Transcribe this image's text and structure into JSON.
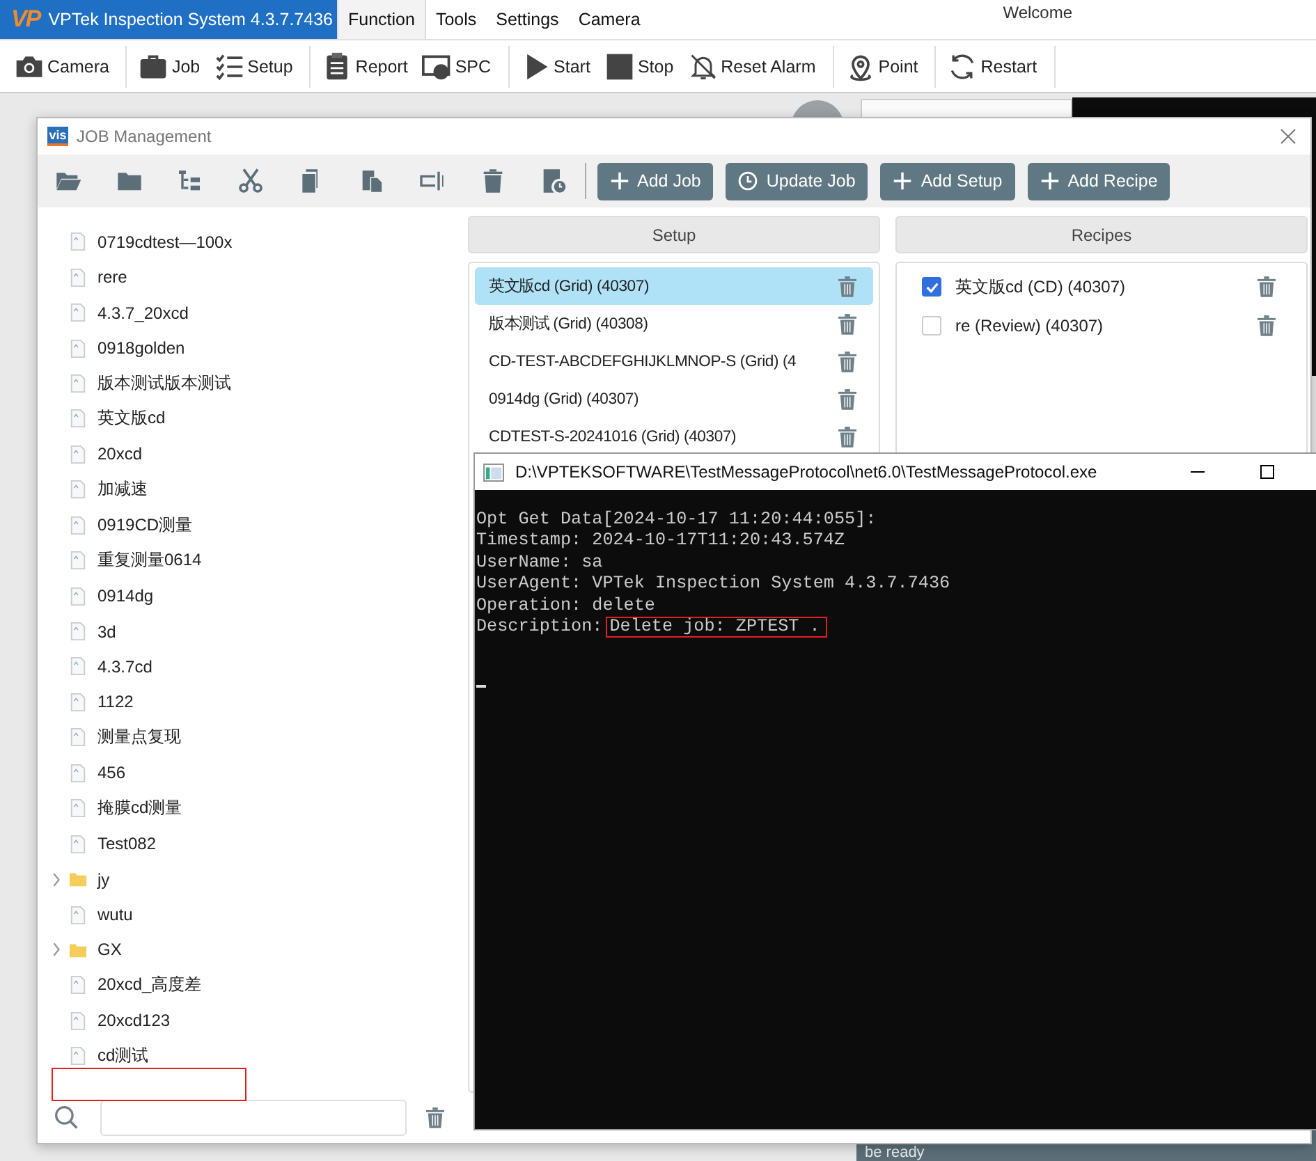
{
  "app": {
    "logo": "VP",
    "title": "VPTek Inspection System 4.3.7.7436",
    "greeting": "Welcome",
    "menu": [
      {
        "label": "Function",
        "selected": true
      },
      {
        "label": "Tools",
        "selected": false
      },
      {
        "label": "Settings",
        "selected": false
      },
      {
        "label": "Camera",
        "selected": false
      }
    ],
    "toolbar": [
      [
        {
          "label": "Camera",
          "kind": "camera"
        }
      ],
      [
        {
          "label": "Job",
          "kind": "job"
        },
        {
          "label": "Setup",
          "kind": "setup"
        }
      ],
      [
        {
          "label": "Report",
          "kind": "report"
        },
        {
          "label": "SPC",
          "kind": "spc"
        }
      ],
      [
        {
          "label": "Start",
          "kind": "start"
        },
        {
          "label": "Stop",
          "kind": "stop"
        },
        {
          "label": "Reset Alarm",
          "kind": "alarm"
        }
      ],
      [
        {
          "label": "Point",
          "kind": "point"
        }
      ],
      [
        {
          "label": "Restart",
          "kind": "restart"
        }
      ]
    ],
    "status": "be ready"
  },
  "job_window": {
    "logo": "vis",
    "title": "JOB Management",
    "tools": [
      {
        "kind": "open"
      },
      {
        "kind": "folder"
      },
      {
        "kind": "tree"
      },
      {
        "kind": "cut"
      },
      {
        "kind": "copy"
      },
      {
        "kind": "paste"
      },
      {
        "kind": "rename"
      },
      {
        "kind": "delete"
      },
      {
        "kind": "history"
      }
    ],
    "actions": [
      {
        "label": "Add Job",
        "kind": "plus"
      },
      {
        "label": "Update Job",
        "kind": "clock"
      },
      {
        "label": "Add Setup",
        "kind": "plus"
      },
      {
        "label": "Add Recipe",
        "kind": "plus"
      }
    ],
    "tree": [
      {
        "label": "0719cdtest—100x",
        "kind": "file"
      },
      {
        "label": "rere",
        "kind": "file"
      },
      {
        "label": "4.3.7_20xcd",
        "kind": "file"
      },
      {
        "label": "0918golden",
        "kind": "file"
      },
      {
        "label": "版本测试版本测试",
        "kind": "file"
      },
      {
        "label": "英文版cd",
        "kind": "file"
      },
      {
        "label": "20xcd",
        "kind": "file"
      },
      {
        "label": "加减速",
        "kind": "file"
      },
      {
        "label": "0919CD测量",
        "kind": "file"
      },
      {
        "label": "重复测量0614",
        "kind": "file"
      },
      {
        "label": "0914dg",
        "kind": "file"
      },
      {
        "label": "3d",
        "kind": "file"
      },
      {
        "label": "4.3.7cd",
        "kind": "file"
      },
      {
        "label": "1122",
        "kind": "file"
      },
      {
        "label": "测量点复现",
        "kind": "file"
      },
      {
        "label": "456",
        "kind": "file"
      },
      {
        "label": "掩膜cd测量",
        "kind": "file"
      },
      {
        "label": "Test082",
        "kind": "file"
      },
      {
        "label": "jy",
        "kind": "folder",
        "expanded": false
      },
      {
        "label": "wutu",
        "kind": "file"
      },
      {
        "label": "GX",
        "kind": "folder",
        "expanded": false
      },
      {
        "label": "20xcd_高度差",
        "kind": "file"
      },
      {
        "label": "20xcd123",
        "kind": "file"
      },
      {
        "label": "cd测试",
        "kind": "file"
      }
    ],
    "setup": {
      "header": "Setup",
      "items": [
        {
          "label": "英文版cd (Grid) (40307)",
          "selected": true
        },
        {
          "label": "版本测试 (Grid) (40308)",
          "selected": false
        },
        {
          "label": "CD-TEST-ABCDEFGHIJKLMNOP-S (Grid) (4",
          "selected": false
        },
        {
          "label": "0914dg (Grid) (40307)",
          "selected": false
        },
        {
          "label": "CDTEST-S-20241016 (Grid) (40307)",
          "selected": false
        }
      ]
    },
    "recipes": {
      "header": "Recipes",
      "items": [
        {
          "label": "英文版cd (CD) (40307)",
          "checked": true
        },
        {
          "label": "re (Review) (40307)",
          "checked": false
        }
      ]
    }
  },
  "console": {
    "title": "D:\\VPTEKSOFTWARE\\TestMessageProtocol\\net6.0\\TestMessageProtocol.exe",
    "lines": [
      {
        "text": "Opt Get Data[2024-10-17 11:20:44:055]:"
      },
      {
        "text": "Timestamp: 2024-10-17T11:20:43.574Z"
      },
      {
        "text": "UserName: sa"
      },
      {
        "text": "UserAgent: VPTek Inspection System 4.3.7.7436"
      },
      {
        "text": "Operation: delete"
      },
      {
        "text": "Description:",
        "boxed": "Delete job: ZPTEST ."
      }
    ]
  }
}
